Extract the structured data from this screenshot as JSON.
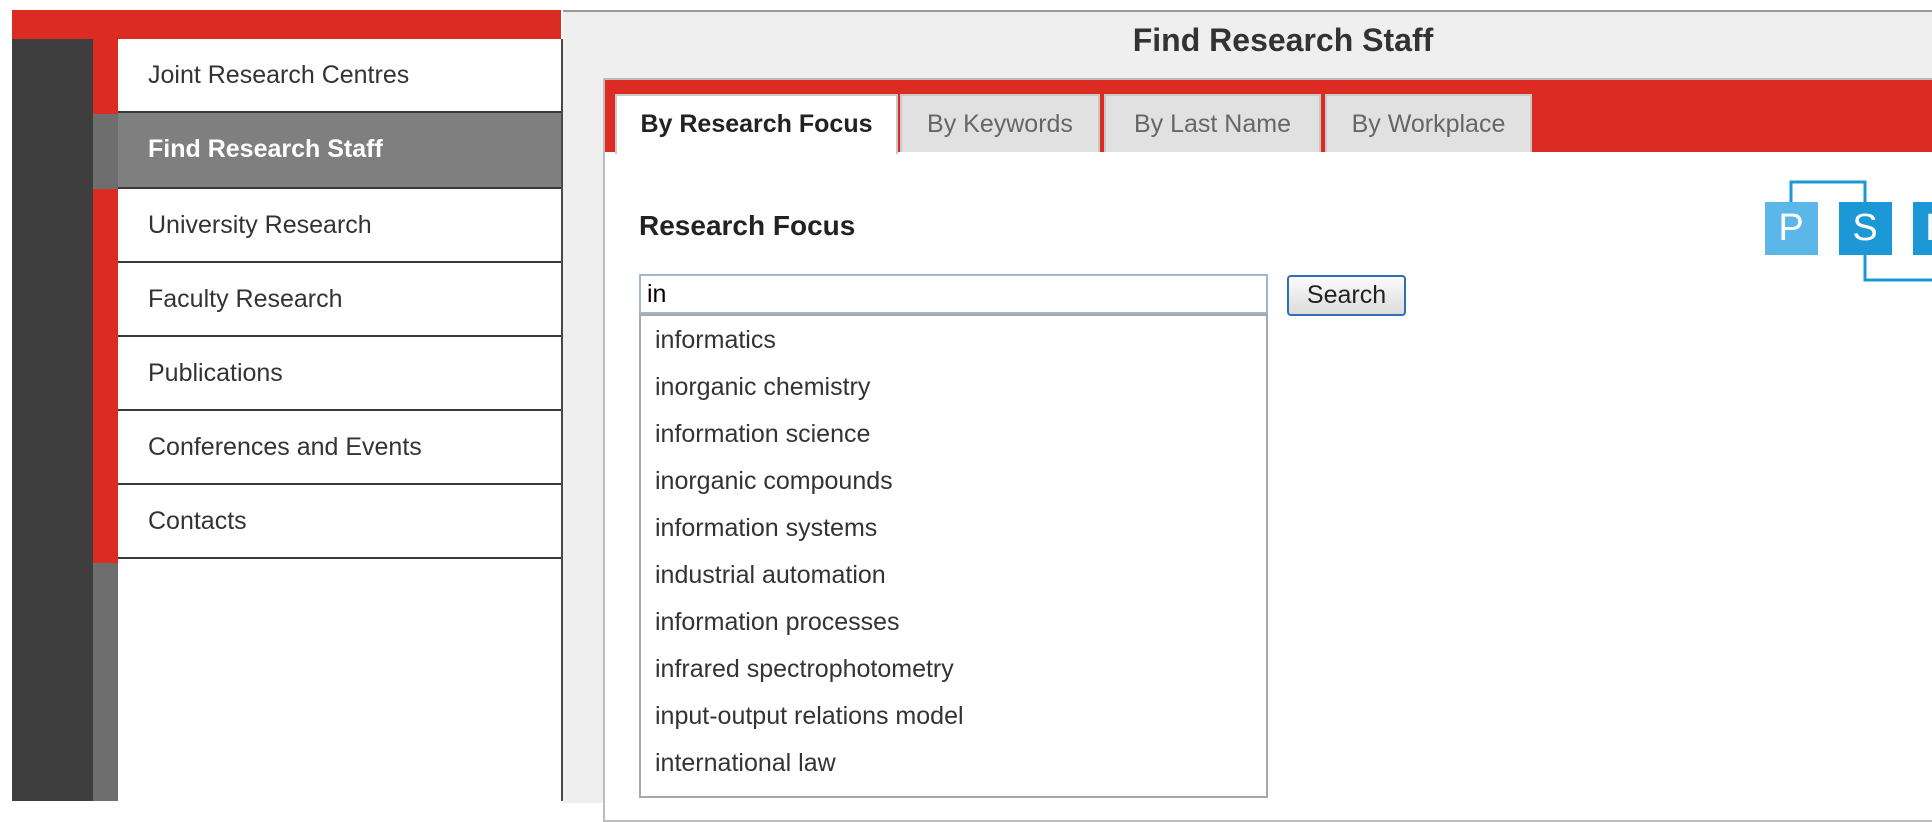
{
  "nav": {
    "items": [
      {
        "label": "Joint Research Centres"
      },
      {
        "label": "Find Research Staff"
      },
      {
        "label": "University Research"
      },
      {
        "label": "Faculty Research"
      },
      {
        "label": "Publications"
      },
      {
        "label": "Conferences and Events"
      },
      {
        "label": "Contacts"
      }
    ],
    "active_index": 1
  },
  "page": {
    "title": "Find Research Staff"
  },
  "tabs": [
    {
      "label": "By Research Focus",
      "active": true
    },
    {
      "label": "By Keywords",
      "active": false
    },
    {
      "label": "By Last Name",
      "active": false
    },
    {
      "label": "By Workplace",
      "active": false
    }
  ],
  "search": {
    "section_title": "Research Focus",
    "value": "in",
    "button_label": "Search"
  },
  "suggestions": [
    "informatics",
    "inorganic chemistry",
    "information science",
    "inorganic compounds",
    "information systems",
    "industrial automation",
    "information processes",
    "infrared spectrophotometry",
    "input-output relations model",
    "international law"
  ],
  "logo": {
    "letters": [
      "P",
      "S",
      "H"
    ]
  },
  "colors": {
    "accent_red": "#dc2b22",
    "nav_active_bg": "#7f7f7f",
    "logo_light_blue": "#5bb7e8",
    "logo_blue": "#1c98d6"
  }
}
